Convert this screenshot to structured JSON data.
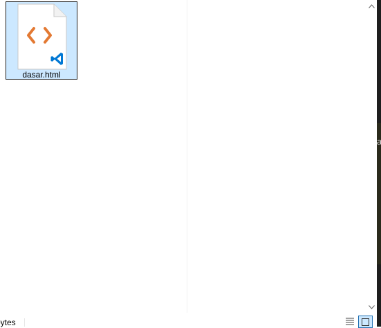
{
  "files": [
    {
      "name": "dasar.html",
      "icon": "vscode-html-file-icon",
      "selected": true
    }
  ],
  "statusbar": {
    "selection_text": "bytes"
  },
  "outside": {
    "char": "a"
  },
  "colors": {
    "selection_bg": "#cce8ff",
    "html_brackets": "#e37933",
    "vscode_blue": "#0078d4"
  }
}
